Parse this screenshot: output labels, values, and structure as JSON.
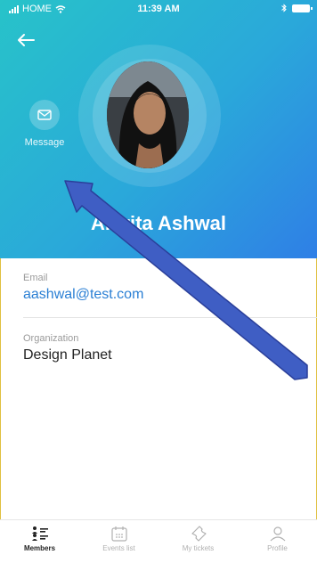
{
  "status_bar": {
    "carrier": "HOME",
    "time": "11:39 AM"
  },
  "header": {
    "back_icon": "back-arrow-icon",
    "message_label": "Message",
    "message_icon": "envelope-icon",
    "name": "Amrita Ashwal"
  },
  "contact": {
    "email_label": "Email",
    "email_value": "aashwal@test.com",
    "org_label": "Organization",
    "org_value": "Design Planet"
  },
  "tabbar": {
    "items": [
      {
        "label": "Members",
        "icon": "members-icon",
        "active": true
      },
      {
        "label": "Events list",
        "icon": "calendar-icon",
        "active": false
      },
      {
        "label": "My tickets",
        "icon": "ticket-icon",
        "active": false
      },
      {
        "label": "Profile",
        "icon": "profile-icon",
        "active": false
      }
    ]
  },
  "colors": {
    "header_gradient_start": "#27c3c9",
    "header_gradient_end": "#2f7fe6",
    "link": "#2a7fd4",
    "annotation_arrow": "#3f5ec4"
  }
}
